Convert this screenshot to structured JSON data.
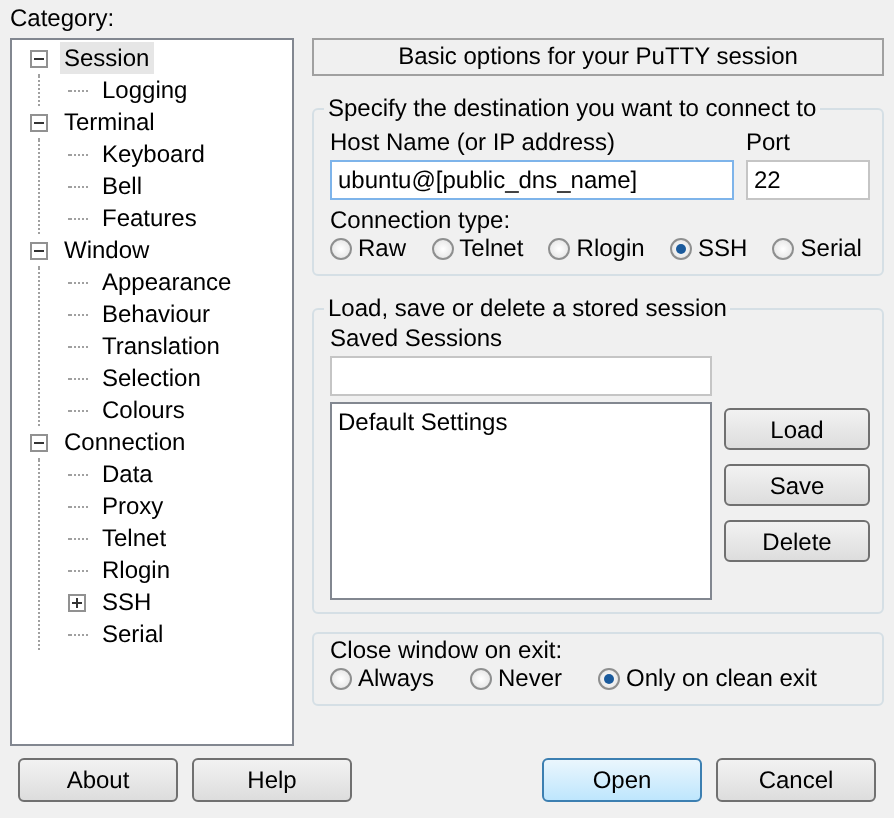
{
  "category_label": "Category:",
  "tree": [
    {
      "label": "Session",
      "selected": true,
      "expanded": true,
      "children": [
        {
          "label": "Logging",
          "selected": false
        }
      ]
    },
    {
      "label": "Terminal",
      "selected": false,
      "expanded": true,
      "children": [
        {
          "label": "Keyboard",
          "selected": false
        },
        {
          "label": "Bell",
          "selected": false
        },
        {
          "label": "Features",
          "selected": false
        }
      ]
    },
    {
      "label": "Window",
      "selected": false,
      "expanded": true,
      "children": [
        {
          "label": "Appearance",
          "selected": false
        },
        {
          "label": "Behaviour",
          "selected": false
        },
        {
          "label": "Translation",
          "selected": false
        },
        {
          "label": "Selection",
          "selected": false
        },
        {
          "label": "Colours",
          "selected": false
        }
      ]
    },
    {
      "label": "Connection",
      "selected": false,
      "expanded": true,
      "children": [
        {
          "label": "Data",
          "selected": false
        },
        {
          "label": "Proxy",
          "selected": false
        },
        {
          "label": "Telnet",
          "selected": false
        },
        {
          "label": "Rlogin",
          "selected": false
        },
        {
          "label": "SSH",
          "selected": false,
          "expanded": false
        },
        {
          "label": "Serial",
          "selected": false
        }
      ]
    }
  ],
  "banner": "Basic options for your PuTTY session",
  "destination": {
    "legend": "Specify the destination you want to connect to",
    "host_label": "Host Name (or IP address)",
    "host_value": "ubuntu@[public_dns_name]",
    "port_label": "Port",
    "port_value": "22",
    "type_label": "Connection type:",
    "types": [
      {
        "label": "Raw",
        "selected": false
      },
      {
        "label": "Telnet",
        "selected": false
      },
      {
        "label": "Rlogin",
        "selected": false
      },
      {
        "label": "SSH",
        "selected": true
      },
      {
        "label": "Serial",
        "selected": false
      }
    ]
  },
  "sessions": {
    "legend": "Load, save or delete a stored session",
    "saved_label": "Saved Sessions",
    "items": [
      "Default Settings"
    ],
    "buttons": [
      "Load",
      "Save",
      "Delete"
    ]
  },
  "close": {
    "legend": "Close window on exit:",
    "options": [
      {
        "label": "Always",
        "selected": false
      },
      {
        "label": "Never",
        "selected": false
      },
      {
        "label": "Only on clean exit",
        "selected": true
      }
    ]
  },
  "footer_left": [
    "About",
    "Help"
  ],
  "footer_right": [
    "Open",
    "Cancel"
  ]
}
